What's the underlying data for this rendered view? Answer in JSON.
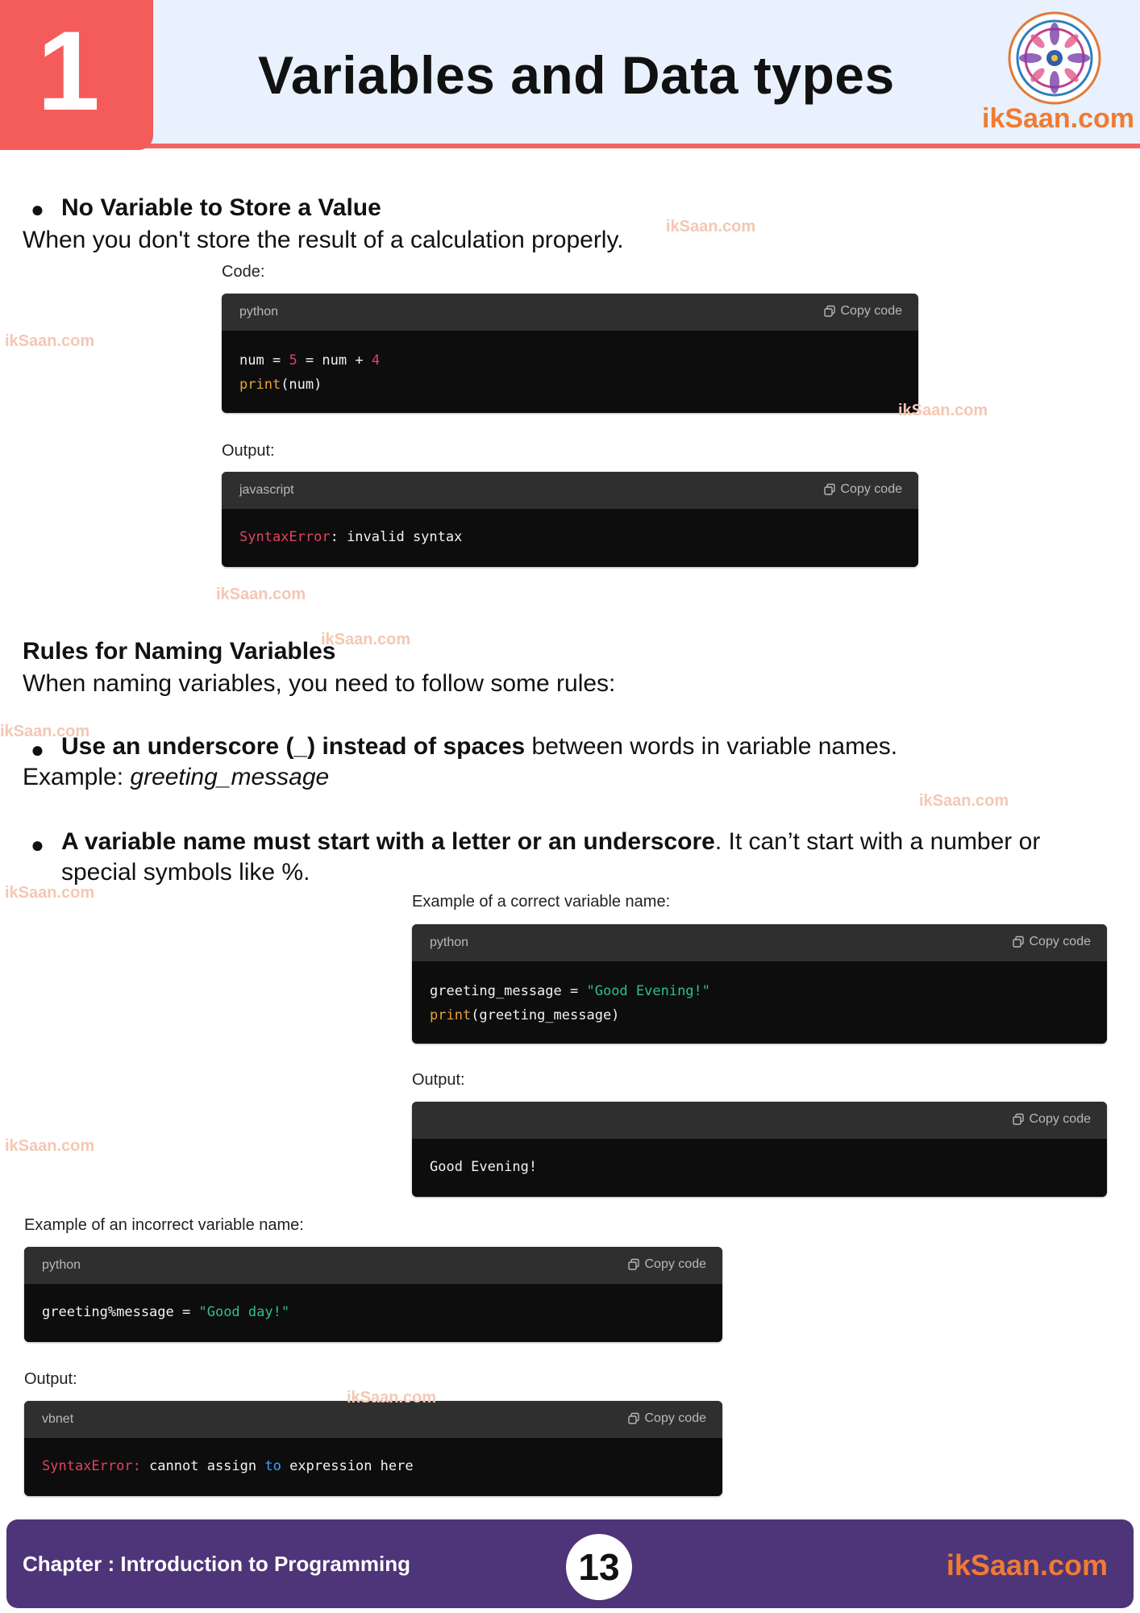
{
  "header": {
    "chapter_number": "1",
    "title": "Variables and Data types",
    "logo_text": "ikSaan.com"
  },
  "section1": {
    "heading": "No Variable to Store a Value",
    "description": "When you don't store the result of a calculation properly.",
    "code_label": "Code:",
    "code_lang": "python",
    "code_line1": [
      "num",
      " = ",
      "5",
      " = ",
      "num",
      " + ",
      "4"
    ],
    "code_line2_fn": "print",
    "code_line2_rest": "(num)",
    "output_label": "Output:",
    "output_lang": "javascript",
    "output_error": "SyntaxError",
    "output_rest": ": invalid syntax"
  },
  "section2": {
    "heading": "Rules for Naming Variables",
    "description": "When naming variables, you need to follow some rules:",
    "rule1_bold": "Use an underscore (_) instead of spaces",
    "rule1_rest": " between words in variable names.",
    "example_label": "Example: ",
    "example_value": "greeting_message",
    "rule2_bold": "A variable name must start with a letter or an underscore",
    "rule2_rest": ". It can’t start with a number or",
    "rule2_line2": "special symbols like %."
  },
  "correct_example": {
    "label": "Example of a correct variable name:",
    "lang": "python",
    "line1_var": "greeting_message",
    "line1_eq": " = ",
    "line1_str": "\"Good Evening!\"",
    "line2_fn": "print",
    "line2_rest": "(greeting_message)",
    "output_label": "Output:",
    "output_text": "Good Evening!"
  },
  "incorrect_example": {
    "label": "Example of an incorrect variable name:",
    "lang": "python",
    "line1_var": "greeting%message",
    "line1_eq": " = ",
    "line1_str": "\"Good day!\"",
    "output_label": "Output:",
    "output_lang": "vbnet",
    "out_err": "SyntaxError:",
    "out_mid": " cannot assign ",
    "out_to": "to",
    "out_end": " expression here"
  },
  "copy_label": "Copy code",
  "watermark": "ikSaan.com",
  "footer": {
    "chapter": "Chapter : Introduction to Programming",
    "page": "13",
    "site": "ikSaan.com"
  },
  "colors": {
    "header_bg": "#e8f1fd",
    "accent_red": "#f45b5b",
    "footer_purple": "#4e3478",
    "brand_orange": "#f07b32"
  }
}
